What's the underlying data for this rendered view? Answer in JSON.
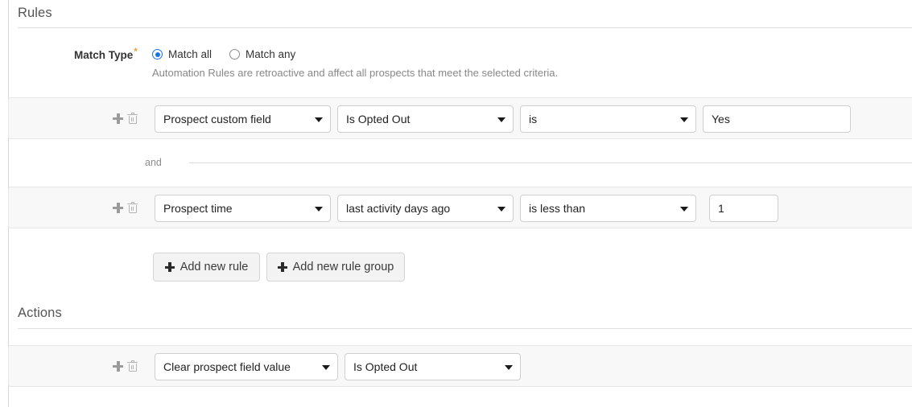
{
  "sections": {
    "rules": {
      "title": "Rules",
      "match_type": {
        "label": "Match Type",
        "required_marker": "*",
        "options": [
          {
            "label": "Match all",
            "selected": true
          },
          {
            "label": "Match any",
            "selected": false
          }
        ],
        "help_text": "Automation Rules are retroactive and affect all prospects that meet the selected criteria."
      },
      "separator_label": "and",
      "rows": [
        {
          "add_icon": "plus-icon",
          "delete_icon": "trash-icon",
          "field_type": "Prospect custom field",
          "field_name": "Is Opted Out",
          "operator": "is",
          "value": "Yes"
        },
        {
          "add_icon": "plus-icon",
          "delete_icon": "trash-icon",
          "field_type": "Prospect time",
          "field_name": "last activity days ago",
          "operator": "is less than",
          "value": "1"
        }
      ],
      "buttons": [
        {
          "label": "Add new rule",
          "icon": "plus-icon"
        },
        {
          "label": "Add new rule group",
          "icon": "plus-icon"
        }
      ]
    },
    "actions": {
      "title": "Actions",
      "rows": [
        {
          "add_icon": "plus-icon",
          "delete_icon": "trash-icon",
          "action_type": "Clear prospect field value",
          "action_target": "Is Opted Out"
        }
      ]
    }
  },
  "colors": {
    "accent": "#1b72e8",
    "required": "#e8a33d",
    "row_background": "#f8f8f8",
    "heading": "#555555"
  }
}
